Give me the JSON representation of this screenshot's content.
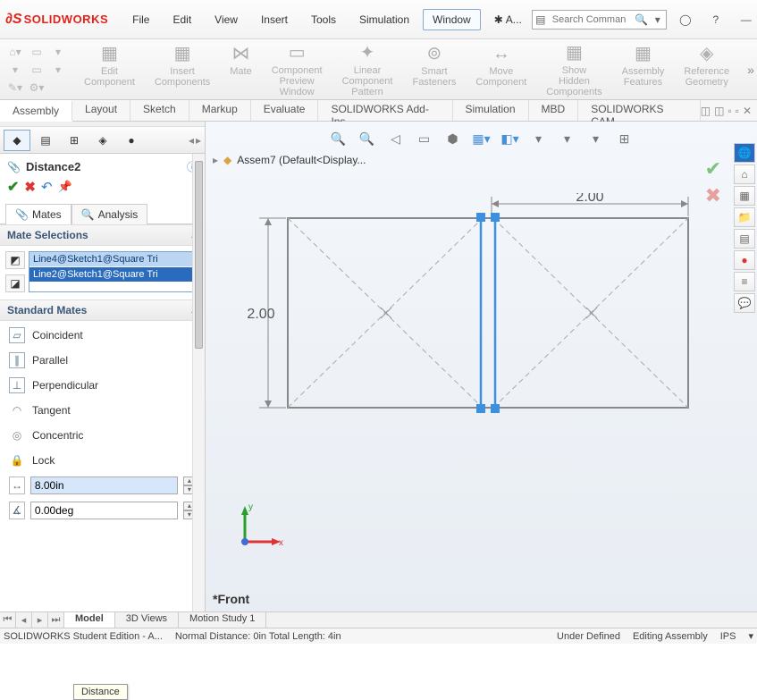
{
  "app": {
    "brand_prefix": "S",
    "brand": "SOLIDWORKS"
  },
  "menu": [
    "File",
    "Edit",
    "View",
    "Insert",
    "Tools",
    "Simulation",
    "Window"
  ],
  "menu_star": "A...",
  "search": {
    "placeholder": "Search Comman"
  },
  "ribbon": {
    "groups": [
      {
        "id": "edit-component",
        "label": "Edit\nComponent"
      },
      {
        "id": "insert-components",
        "label": "Insert\nComponents"
      },
      {
        "id": "mate",
        "label": "Mate"
      },
      {
        "id": "component-preview-window",
        "label": "Component\nPreview\nWindow"
      },
      {
        "id": "linear-component-pattern",
        "label": "Linear Component\nPattern"
      },
      {
        "id": "smart-fasteners",
        "label": "Smart\nFasteners"
      },
      {
        "id": "move-component",
        "label": "Move\nComponent"
      },
      {
        "id": "show-hidden-components",
        "label": "Show\nHidden\nComponents"
      },
      {
        "id": "assembly-features",
        "label": "Assembly\nFeatures"
      },
      {
        "id": "reference-geometry",
        "label": "Reference\nGeometry"
      }
    ]
  },
  "tabs": [
    "Assembly",
    "Layout",
    "Sketch",
    "Markup",
    "Evaluate",
    "SOLIDWORKS Add-Ins",
    "Simulation",
    "MBD",
    "SOLIDWORKS CAM"
  ],
  "active_tab": "Assembly",
  "property": {
    "title": "Distance2",
    "subtabs": {
      "mates": "Mates",
      "analysis": "Analysis"
    },
    "sections": {
      "mate_selections": "Mate Selections",
      "standard_mates": "Standard Mates"
    },
    "selections": [
      "Line4@Sketch1@Square Tri",
      "Line2@Sketch1@Square Tri"
    ],
    "mates": {
      "coincident": "Coincident",
      "parallel": "Parallel",
      "perpendicular": "Perpendicular",
      "tangent": "Tangent",
      "concentric": "Concentric",
      "lock": "Lock"
    },
    "distance_value": "8.00in",
    "angle_value": "0.00deg",
    "tooltip": "Distance"
  },
  "canvas": {
    "crumb": "Assem7  (Default<Display...",
    "dim_h": "2.00",
    "dim_v": "2.00",
    "axes": {
      "x": "x",
      "y": "y"
    },
    "view_label": "*Front"
  },
  "bottom_tabs": [
    "Model",
    "3D Views",
    "Motion Study 1"
  ],
  "active_btab": "Model",
  "status": {
    "left": "SOLIDWORKS Student Edition - A...",
    "dist": "Normal Distance: 0in Total Length: 4in",
    "def": "Under Defined",
    "mode": "Editing Assembly",
    "units": "IPS"
  }
}
